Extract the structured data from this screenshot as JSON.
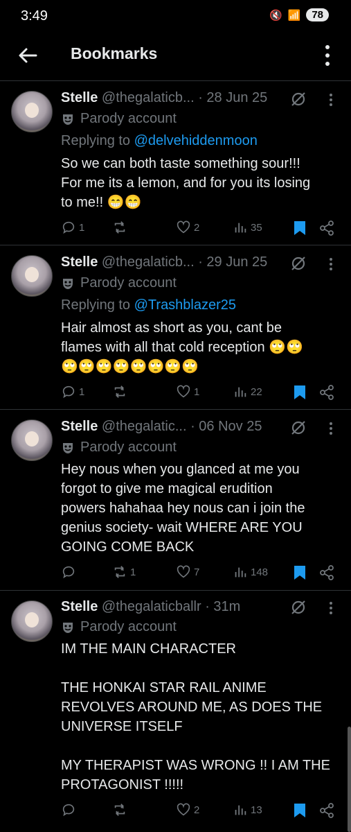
{
  "status_bar": {
    "time": "3:49",
    "battery": "78"
  },
  "header": {
    "title": "Bookmarks"
  },
  "posts": [
    {
      "name": "Stelle",
      "handle": "@thegalaticb...",
      "sep": " · ",
      "date": "28 Jun 25",
      "parody": "Parody account",
      "reply_prefix": "Replying to ",
      "reply_to": "@delvehiddenmoon",
      "text": "So we can both taste something sour!!!\nFor me its a lemon, and for you its losing\nto me!! 😁😁",
      "replies": "1",
      "reposts": "",
      "likes": "2",
      "views": "35"
    },
    {
      "name": "Stelle",
      "handle": "@thegalaticb...",
      "sep": " · ",
      "date": "29 Jun 25",
      "parody": "Parody account",
      "reply_prefix": "Replying to ",
      "reply_to": "@Trashblazer25",
      "text": "Hair almost as short as you, cant be\nflames with all that cold reception 🙄🙄\n🙄🙄🙄🙄🙄🙄🙄🙄",
      "replies": "1",
      "reposts": "",
      "likes": "1",
      "views": "22"
    },
    {
      "name": "Stelle",
      "handle": "@thegalatic...",
      "sep": " · ",
      "date": "06 Nov 25",
      "parody": "Parody account",
      "text": "Hey nous when you glanced at me you\nforgot to give me magical erudition\npowers hahahaa hey nous can i join the\ngenius society- wait WHERE ARE YOU\nGOING COME BACK",
      "replies": "",
      "reposts": "1",
      "likes": "7",
      "views": "148"
    },
    {
      "name": "Stelle",
      "handle": "@thegalaticballr",
      "sep": " · ",
      "date": "31m",
      "parody": "Parody account",
      "text": "IM THE MAIN CHARACTER\n\nTHE HONKAI STAR RAIL ANIME\nREVOLVES AROUND ME, AS DOES THE\nUNIVERSE ITSELF\n\nMY THERAPIST WAS WRONG !! I AM THE\nPROTAGONIST !!!!!",
      "replies": "",
      "reposts": "",
      "likes": "2",
      "views": "13"
    }
  ],
  "colors": {
    "accent": "#1d9bf0",
    "muted": "#71767b",
    "text": "#e7e9ea",
    "bg": "#000000"
  },
  "icons": [
    "back-arrow-icon",
    "more-vertical-icon",
    "parody-mask-icon",
    "no-bell-icon",
    "reply-icon",
    "repost-icon",
    "like-icon",
    "views-icon",
    "bookmark-icon",
    "share-icon"
  ]
}
